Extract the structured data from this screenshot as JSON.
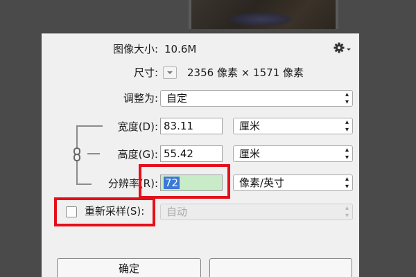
{
  "dialog": {
    "image_size_label": "图像大小:",
    "image_size_value": "10.6M",
    "dimensions_label": "尺寸:",
    "dimensions_value": "2356 像素  ×  1571 像素",
    "fit_to_label": "调整为:",
    "fit_to_value": "自定",
    "width_label": "宽度(D):",
    "width_value": "83.11",
    "width_unit": "厘米",
    "height_label": "高度(G):",
    "height_value": "55.42",
    "height_unit": "厘米",
    "resolution_label": "分辨率(R):",
    "resolution_value": "72",
    "resolution_unit": "像素/英寸",
    "resample_label": "重新采样(S):",
    "resample_value": "自动",
    "resample_checked": false,
    "ok_label": "确定",
    "cancel_label": ""
  },
  "icons": {
    "settings": "gear-icon",
    "dimensions_dropdown": "chevron-down-icon",
    "constrain_proportions": "chain-link-icon"
  },
  "colors": {
    "highlight": "#e3101a",
    "dialog_bg": "#f0f0f0",
    "selection": "#3b78d8",
    "field_highlight_bg": "#c8ebc8"
  }
}
